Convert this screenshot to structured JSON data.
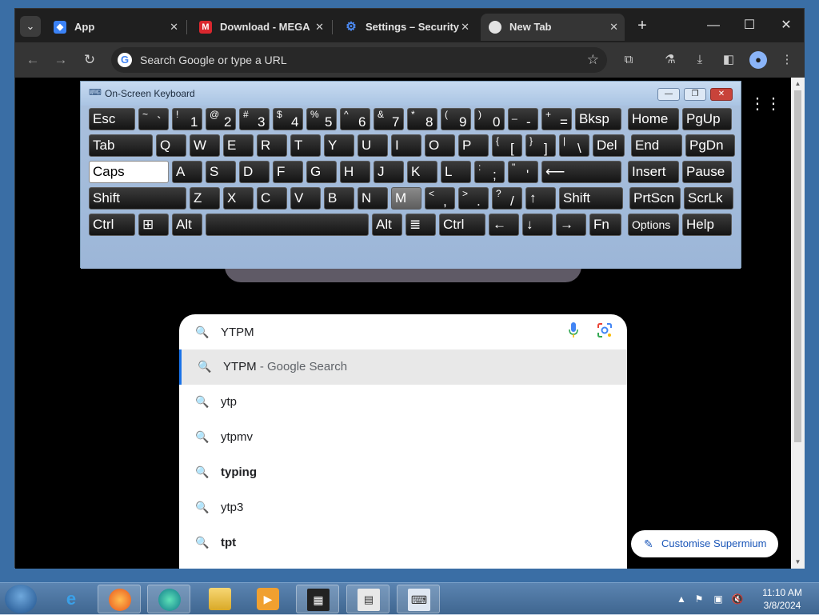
{
  "browser": {
    "tabs": [
      {
        "label": "App",
        "favicon": "app-icon",
        "color": "#3b82f6"
      },
      {
        "label": "Download - MEGA",
        "favicon": "mega-icon",
        "color": "#d9272e"
      },
      {
        "label": "Settings – Security",
        "favicon": "gear-icon",
        "color": "#4c8bf5"
      },
      {
        "label": "New Tab",
        "favicon": "newtab-icon",
        "color": "#e3e3e3"
      }
    ],
    "omnibox_placeholder": "Search Google or type a URL"
  },
  "osk": {
    "title": "On-Screen Keyboard",
    "rows": [
      [
        {
          "m": "Esc"
        },
        {
          "s": "~",
          "m": "`"
        },
        {
          "s": "!",
          "m": "1"
        },
        {
          "s": "@",
          "m": "2"
        },
        {
          "s": "#",
          "m": "3"
        },
        {
          "s": "$",
          "m": "4"
        },
        {
          "s": "%",
          "m": "5"
        },
        {
          "s": "^",
          "m": "6"
        },
        {
          "s": "&",
          "m": "7"
        },
        {
          "s": "*",
          "m": "8"
        },
        {
          "s": "(",
          "m": "9"
        },
        {
          "s": ")",
          "m": "0"
        },
        {
          "s": "_",
          "m": "-"
        },
        {
          "s": "+",
          "m": "="
        },
        {
          "m": "Bksp"
        },
        {
          "m": "Home"
        },
        {
          "m": "PgUp"
        }
      ],
      [
        {
          "m": "Tab"
        },
        {
          "m": "Q"
        },
        {
          "m": "W"
        },
        {
          "m": "E"
        },
        {
          "m": "R"
        },
        {
          "m": "T"
        },
        {
          "m": "Y"
        },
        {
          "m": "U"
        },
        {
          "m": "I"
        },
        {
          "m": "O"
        },
        {
          "m": "P"
        },
        {
          "s": "{",
          "m": "["
        },
        {
          "s": "}",
          "m": "]"
        },
        {
          "s": "|",
          "m": "\\"
        },
        {
          "m": "Del"
        },
        {
          "m": "End"
        },
        {
          "m": "PgDn"
        }
      ],
      [
        {
          "m": "Caps"
        },
        {
          "m": "A"
        },
        {
          "m": "S"
        },
        {
          "m": "D"
        },
        {
          "m": "F"
        },
        {
          "m": "G"
        },
        {
          "m": "H"
        },
        {
          "m": "J"
        },
        {
          "m": "K"
        },
        {
          "m": "L"
        },
        {
          "s": ":",
          "m": ";"
        },
        {
          "s": "\"",
          "m": "'"
        },
        {
          "m": "⟵"
        },
        {
          "m": "Insert"
        },
        {
          "m": "Pause"
        }
      ],
      [
        {
          "m": "Shift"
        },
        {
          "m": "Z"
        },
        {
          "m": "X"
        },
        {
          "m": "C"
        },
        {
          "m": "V"
        },
        {
          "m": "B"
        },
        {
          "m": "N"
        },
        {
          "m": "M"
        },
        {
          "s": "<",
          "m": ","
        },
        {
          "s": ">",
          "m": "."
        },
        {
          "s": "?",
          "m": "/"
        },
        {
          "m": "↑"
        },
        {
          "m": "Shift"
        },
        {
          "m": "PrtScn"
        },
        {
          "m": "ScrLk"
        }
      ],
      [
        {
          "m": "Ctrl"
        },
        {
          "m": "⊞"
        },
        {
          "m": "Alt"
        },
        {
          "m": ""
        },
        {
          "m": "Alt"
        },
        {
          "m": "≣"
        },
        {
          "m": "Ctrl"
        },
        {
          "m": "←"
        },
        {
          "m": "↓"
        },
        {
          "m": "→"
        },
        {
          "m": "Fn"
        },
        {
          "m": "Options"
        },
        {
          "m": "Help"
        }
      ]
    ]
  },
  "search": {
    "query": "YTPM",
    "suggestions": [
      {
        "text": "YTPM",
        "suffix": " - Google Search",
        "bold": false
      },
      {
        "text": "ytp",
        "suffix": "",
        "bold": false
      },
      {
        "text": "ytpmv",
        "suffix": "",
        "bold": false
      },
      {
        "text": "typing",
        "suffix": "",
        "bold": true
      },
      {
        "text": "ytp3",
        "suffix": "",
        "bold": false
      },
      {
        "text": "tpt",
        "suffix": "",
        "bold": true
      }
    ]
  },
  "customise_label": "Customise Supermium",
  "taskbar": {
    "items": [
      "ie-icon",
      "firefox-icon",
      "edge-icon",
      "explorer-icon",
      "media-player-icon",
      "film-icon",
      "notepad-icon",
      "keyboard-icon"
    ],
    "time": "11:10 AM",
    "date": "3/8/2024"
  }
}
